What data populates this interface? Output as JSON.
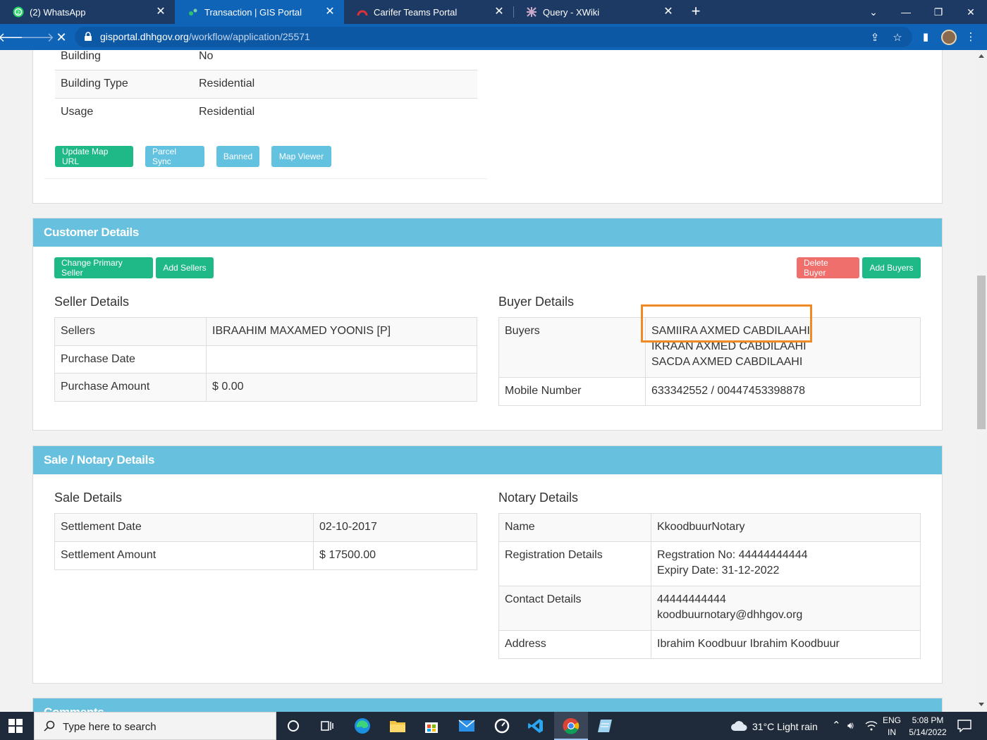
{
  "browser": {
    "tabs": [
      {
        "title": "(2) WhatsApp",
        "active": false
      },
      {
        "title": "Transaction | GIS Portal",
        "active": true
      },
      {
        "title": "Carifer Teams Portal",
        "active": false
      },
      {
        "title": "Query - XWiki",
        "active": false
      }
    ],
    "url_host": "gisportal.dhhgov.org",
    "url_path": "/workflow/application/25571"
  },
  "property": {
    "rows": [
      {
        "label": "Building",
        "value": "No"
      },
      {
        "label": "Building Type",
        "value": "Residential"
      },
      {
        "label": "Usage",
        "value": "Residential"
      }
    ],
    "buttons": [
      "Update Map URL",
      "Parcel Sync",
      "Banned",
      "Map Viewer"
    ]
  },
  "customer": {
    "title": "Customer Details",
    "buttons": {
      "change_primary_seller": "Change Primary Seller",
      "add_sellers": "Add Sellers",
      "delete_buyer": "Delete Buyer",
      "add_buyers": "Add Buyers"
    },
    "seller": {
      "heading": "Seller Details",
      "sellers_label": "Sellers",
      "sellers_value": "IBRAAHIM MAXAMED YOONIS [P]",
      "purchase_date_label": "Purchase Date",
      "purchase_date_value": "",
      "purchase_amount_label": "Purchase Amount",
      "purchase_amount_value": "$ 0.00"
    },
    "buyer": {
      "heading": "Buyer Details",
      "buyers_label": "Buyers",
      "buyers": [
        "SAMIIRA AXMED CABDILAAHI",
        "IKRAAN AXMED CABDILAAHI",
        "SACDA AXMED CABDILAAHI"
      ],
      "mobile_label": "Mobile Number",
      "mobile_value": "633342552 / 00447453398878"
    }
  },
  "sale": {
    "title": "Sale / Notary Details",
    "sale_heading": "Sale Details",
    "settlement_date_label": "Settlement Date",
    "settlement_date_value": "02-10-2017",
    "settlement_amount_label": "Settlement Amount",
    "settlement_amount_value": "$ 17500.00",
    "notary_heading": "Notary Details",
    "name_label": "Name",
    "name_value": "KkoodbuurNotary",
    "registration_label": "Registration Details",
    "registration_no": "Regstration No: 44444444444",
    "expiry_date": "Expiry Date: 31-12-2022",
    "contact_label": "Contact Details",
    "contact_phone": "44444444444",
    "contact_email": "koodbuurnotary@dhhgov.org",
    "address_label": "Address",
    "address_value": "Ibrahim Koodbuur Ibrahim Koodbuur"
  },
  "comments": {
    "title": "Comments"
  },
  "taskbar": {
    "search_placeholder": "Type here to search",
    "weather": "31°C  Light rain",
    "lang_top": "ENG",
    "lang_bottom": "IN",
    "time": "5:08 PM",
    "date": "5/14/2022"
  },
  "colors": {
    "panel_header": "#67c0dd",
    "btn_green": "#1fb887",
    "btn_cyan": "#63c2e0",
    "btn_red": "#ef6f6c",
    "highlight": "#f08a24",
    "chrome": "#0f64b8"
  }
}
